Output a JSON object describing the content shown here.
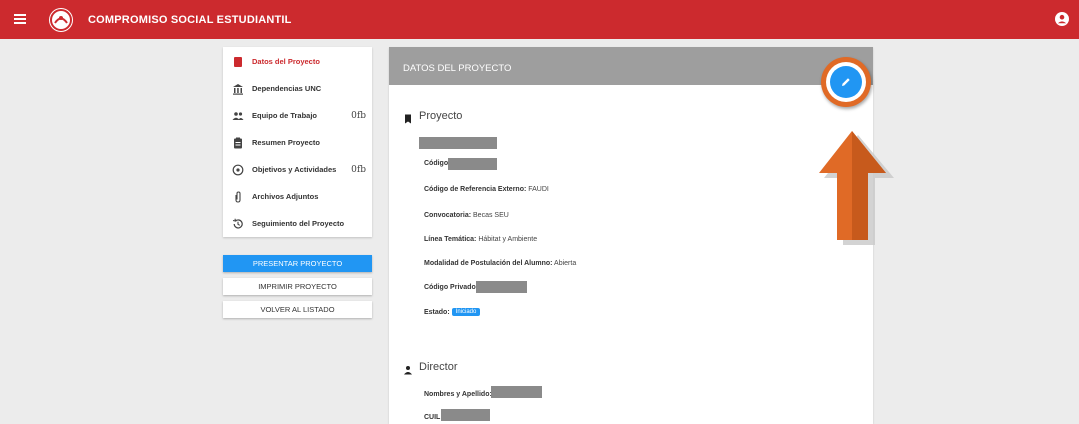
{
  "topbar": {
    "app_title": "COMPROMISO SOCIAL ESTUDIANTIL"
  },
  "sidebar": {
    "items": [
      {
        "label": "Datos del Proyecto",
        "icon": "folder-icon",
        "badge": ""
      },
      {
        "label": "Dependencias UNC",
        "icon": "institution-icon",
        "badge": ""
      },
      {
        "label": "Equipo de Trabajo",
        "icon": "people-icon",
        "badge": "0fb"
      },
      {
        "label": "Resumen Proyecto",
        "icon": "clipboard-icon",
        "badge": ""
      },
      {
        "label": "Objetivos y Actividades",
        "icon": "target-icon",
        "badge": "0fb"
      },
      {
        "label": "Archivos Adjuntos",
        "icon": "paperclip-icon",
        "badge": ""
      },
      {
        "label": "Seguimiento del Proyecto",
        "icon": "history-icon",
        "badge": ""
      }
    ]
  },
  "buttons": {
    "present": "PRESENTAR PROYECTO",
    "print": "IMPRIMIR PROYECTO",
    "back": "VOLVER AL LISTADO"
  },
  "panel": {
    "header_title": "DATOS DEL PROYECTO",
    "project_section_title": "Proyecto",
    "fields": {
      "codigo_label": "Código:",
      "codigo_ref_label": "Código de Referencia Externo:",
      "codigo_ref_value": "FAUDI",
      "convocatoria_label": "Convocatoria:",
      "convocatoria_value": "Becas SEU",
      "linea_label": "Línea Temática:",
      "linea_value": "Hábitat y Ambiente",
      "modalidad_label": "Modalidad de Postulación del Alumno:",
      "modalidad_value": "Abierta",
      "codigo_privado_label": "Código Privado:",
      "estado_label": "Estado:",
      "estado_value": "Iniciado"
    },
    "director_section_title": "Director",
    "director_fields": {
      "nombres_label": "Nombres y Apellido:",
      "cuil_label": "CUIL:"
    }
  },
  "colors": {
    "brand_red": "#cc2a2e",
    "primary_blue": "#2196f3",
    "header_gray": "#9e9e9e",
    "annotation_orange": "#e06a26"
  }
}
